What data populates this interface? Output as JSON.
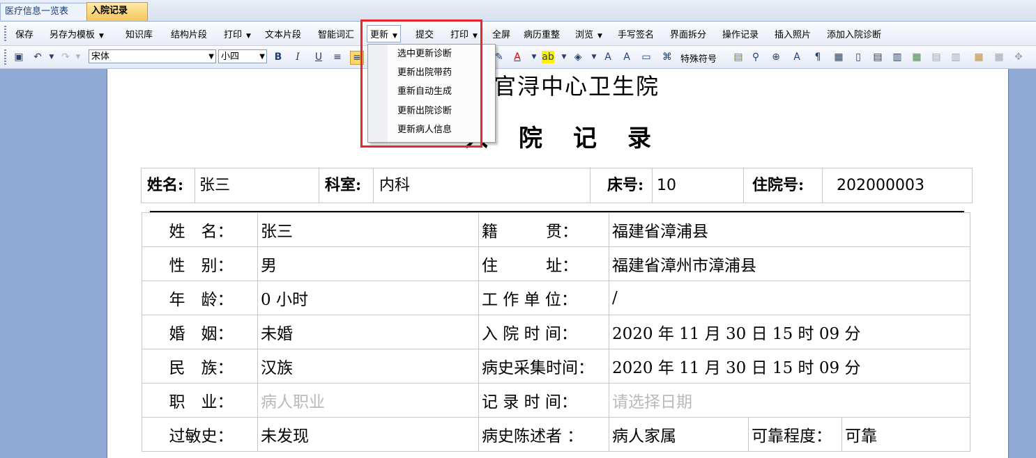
{
  "tabs": [
    {
      "label": "医疗信息一览表"
    },
    {
      "label": "入院记录"
    }
  ],
  "menubar": {
    "items": [
      "保存",
      "另存为模板",
      "知识库",
      "结构片段",
      "打印",
      "文本片段",
      "智能词汇",
      "更新",
      "提交",
      "打印",
      "全屏",
      "病历重整",
      "浏览",
      "手写签名",
      "界面拆分",
      "操作记录",
      "插入照片",
      "添加入院诊断"
    ]
  },
  "format": {
    "font": "宋体",
    "size": "小四",
    "special_symbol": "特殊符号"
  },
  "dropdown": {
    "items": [
      "选中更新诊断",
      "更新出院带药",
      "重新自动生成",
      "更新出院诊断",
      "更新病人信息"
    ]
  },
  "document": {
    "hospital": "县官浔中心卫生院",
    "title": "入院记录",
    "header": {
      "name_label": "姓名:",
      "name": "张三",
      "dept_label": "科室:",
      "dept": "内科",
      "bed_label": "床号:",
      "bed": "10",
      "admission_label": "住院号:",
      "admission_no": "202000003"
    },
    "rows": [
      {
        "l1": "姓　名：",
        "v1": "张三",
        "l2": "籍　　　贯：",
        "v2": "福建省漳浦县"
      },
      {
        "l1": "性　别：",
        "v1": "男",
        "l2": "住　　　址：",
        "v2": "福建省漳州市漳浦县"
      },
      {
        "l1": "年　龄：",
        "v1": "0 小时",
        "l2": "工 作 单 位：",
        "v2": "/"
      },
      {
        "l1": "婚　姻：",
        "v1": "未婚",
        "l2": "入 院 时 间：",
        "v2": "2020 年 11 月 30 日 15 时 09 分"
      },
      {
        "l1": "民　族：",
        "v1": "汉族",
        "l2": "病史采集时间：",
        "v2": "2020 年 11 月 30 日 15 时 09 分"
      },
      {
        "l1": "职　业：",
        "v1": "病人职业",
        "l2": "记 录 时 间：",
        "v2": "请选择日期"
      },
      {
        "l1": "过敏史：",
        "v1": "未发现",
        "l2": "病史陈述者 ：",
        "v2": "病人家属",
        "l3": "可靠程度：",
        "v3": "可靠"
      }
    ]
  }
}
